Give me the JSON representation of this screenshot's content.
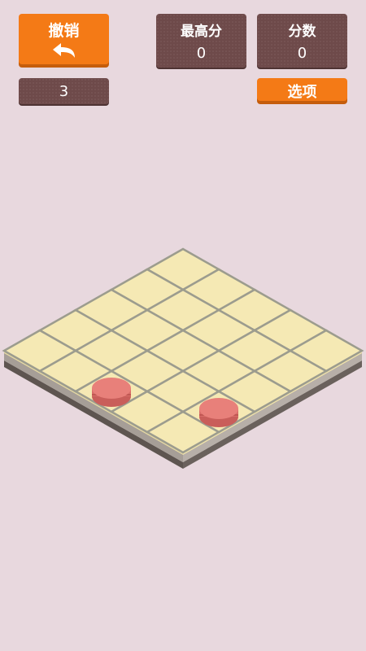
{
  "undo": {
    "label": "撤销",
    "icon": "undo-arrow-icon"
  },
  "moves": {
    "value": "3"
  },
  "best_score": {
    "title": "最高分",
    "value": "0"
  },
  "score": {
    "title": "分数",
    "value": "0"
  },
  "options": {
    "label": "选项"
  },
  "board": {
    "rows": 5,
    "cols": 5,
    "pieces": [
      {
        "row": 3,
        "col": 4,
        "color": "#e8807a"
      },
      {
        "row": 4,
        "col": 2,
        "color": "#e8807a"
      }
    ]
  },
  "colors": {
    "background": "#e8d8de",
    "accent_orange": "#f47a16",
    "panel_brown": "#6e4a4a",
    "tile": "#f5e9b4",
    "grid_line": "#9c9c8e",
    "piece": "#e8807a"
  }
}
